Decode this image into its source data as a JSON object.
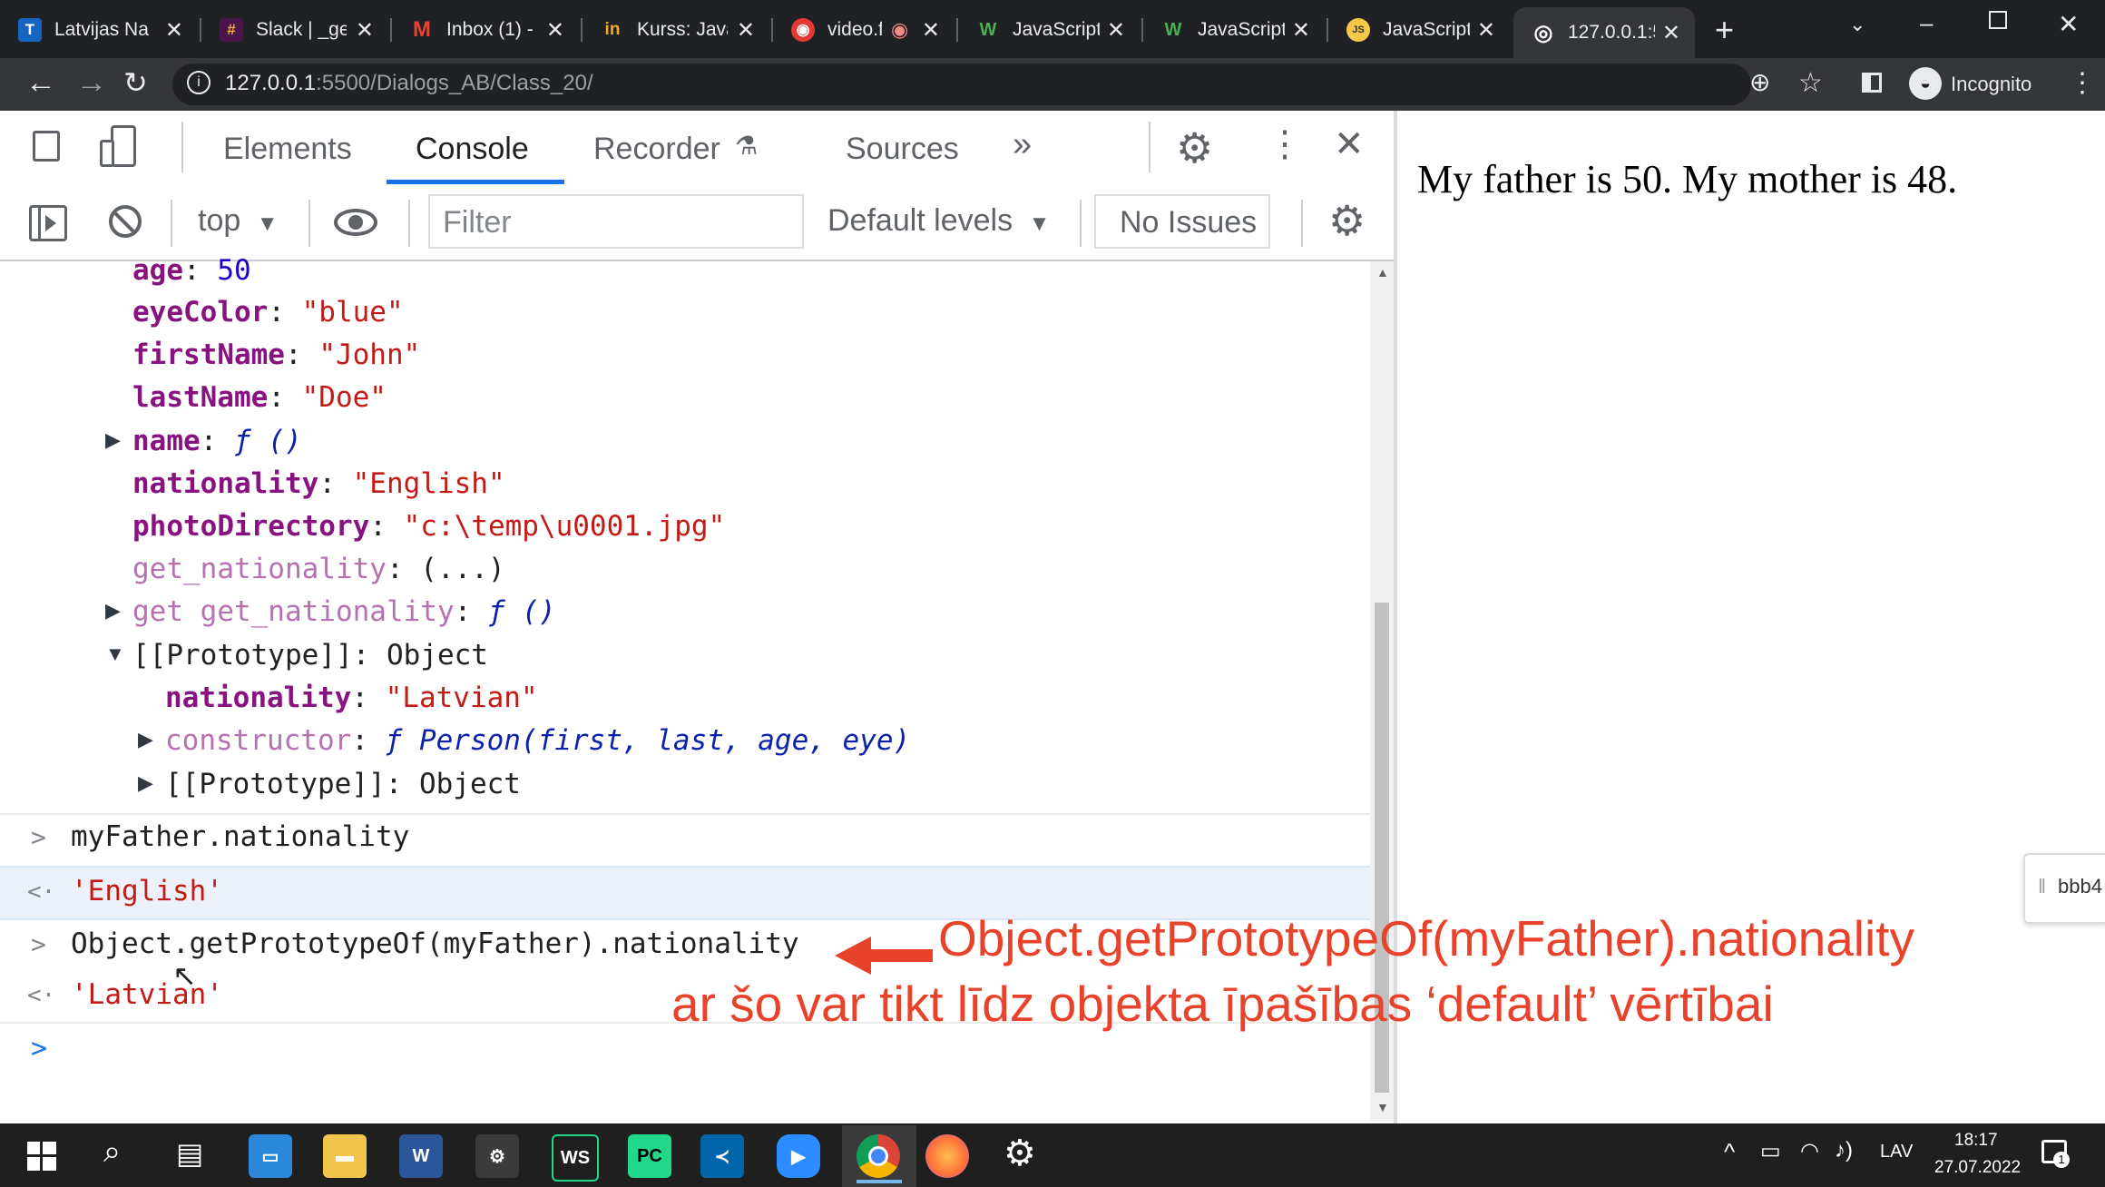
{
  "browser": {
    "tabs": [
      {
        "title": "Latvijas Na",
        "icon": "T"
      },
      {
        "title": "Slack | _ge",
        "icon": "#"
      },
      {
        "title": "Inbox (1) -",
        "icon": "M"
      },
      {
        "title": "Kurss: Java",
        "icon": "in"
      },
      {
        "title": "video.f",
        "icon": "◉"
      },
      {
        "title": "JavaScript",
        "icon": "W"
      },
      {
        "title": "JavaScript",
        "icon": "W"
      },
      {
        "title": "JavaScript",
        "icon": "JS"
      },
      {
        "title": "127.0.0.1:5",
        "icon": "◎"
      }
    ],
    "url_host": "127.0.0.1",
    "url_rest": ":5500/Dialogs_AB/Class_20/",
    "profile": "Incognito"
  },
  "devtools": {
    "tabs": [
      "Elements",
      "Console",
      "Recorder",
      "Sources"
    ],
    "active_tab": "Console",
    "more": "»",
    "context": "top",
    "filter_placeholder": "Filter",
    "levels": "Default levels",
    "issues": "No Issues"
  },
  "console": {
    "obj": {
      "age_key": "age",
      "age_val": "50",
      "eye_key": "eyeColor",
      "eye_val": "\"blue\"",
      "first_key": "firstName",
      "first_val": "\"John\"",
      "last_key": "lastName",
      "last_val": "\"Doe\"",
      "name_key": "name",
      "name_val": "ƒ ()",
      "nat_key": "nationality",
      "nat_val": "\"English\"",
      "photo_key": "photoDirectory",
      "photo_val": "\"c:\\temp\\u0001.jpg\"",
      "getnat_key": "get_nationality",
      "getnat_val": "(...)",
      "getget_key": "get get_nationality",
      "getget_val": "ƒ ()",
      "proto_key": "[[Prototype]]",
      "proto_val": "Object",
      "pnat_key": "nationality",
      "pnat_val": "\"Latvian\"",
      "ctor_key": "constructor",
      "ctor_val": "ƒ Person(first, last, age, eye)",
      "proto2_key": "[[Prototype]]",
      "proto2_val": "Object"
    },
    "cmd1": "myFather.nationality",
    "res1": "'English'",
    "cmd2": "Object.getPrototypeOf(myFather).nationality",
    "res2": "'Latvian'"
  },
  "annotation": {
    "line1": "Object.getPrototypeOf(myFather).nationality",
    "line2": "ar šo var tikt līdz objekta īpašības ‘default’ vērtībai"
  },
  "page": {
    "text": "My father is 50. My mother is 48.",
    "side_tab": "bbb4"
  },
  "taskbar": {
    "lang": "LAV",
    "time": "18:17",
    "date": "27.07.2022"
  }
}
